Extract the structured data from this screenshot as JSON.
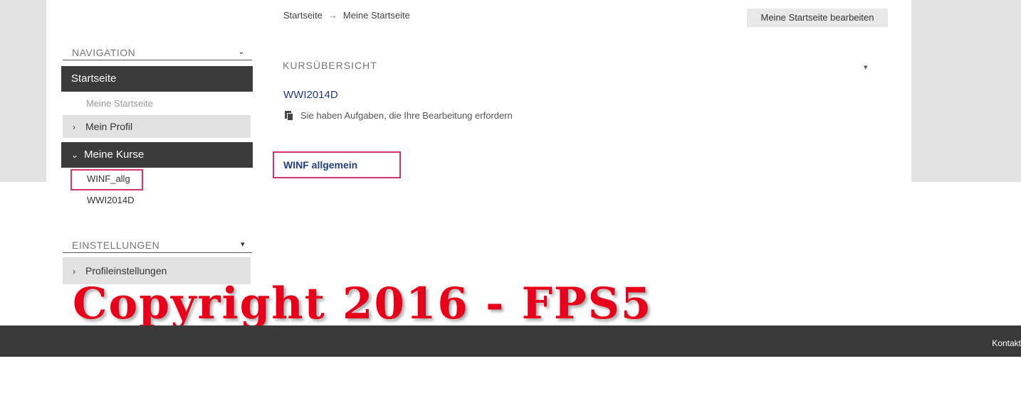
{
  "breadcrumb": {
    "home": "Startseite",
    "separator": "→",
    "current": "Meine Startseite"
  },
  "header": {
    "edit_button": "Meine Startseite bearbeiten"
  },
  "navigation_block": {
    "title": "NAVIGATION",
    "toggle_icon": "chevron-down",
    "items": {
      "home": "Startseite",
      "my_home": "Meine Startseite",
      "my_profile": "Mein Profil",
      "my_courses": "Meine Kurse"
    },
    "courses": [
      "WINF_allg",
      "WWI2014D"
    ]
  },
  "settings_block": {
    "title": "EINSTELLUNGEN",
    "toggle_icon": "chevron-down",
    "items": {
      "profile_settings": "Profileinstellungen"
    }
  },
  "course_overview": {
    "title": "KURSÜBERSICHT",
    "courses": [
      {
        "name": "WWI2014D",
        "note": "Sie haben Aufgaben, die Ihre Bearbeitung erfordern"
      },
      {
        "name": "WINF allgemein"
      }
    ]
  },
  "watermark": "Copyright 2016 - FPS5",
  "footer": {
    "text": "Kontakt"
  },
  "colors": {
    "highlight_box": "#d6336c",
    "link": "#1f3b8a",
    "nav_dark": "#3b3b3b",
    "watermark": "#e8001a"
  }
}
